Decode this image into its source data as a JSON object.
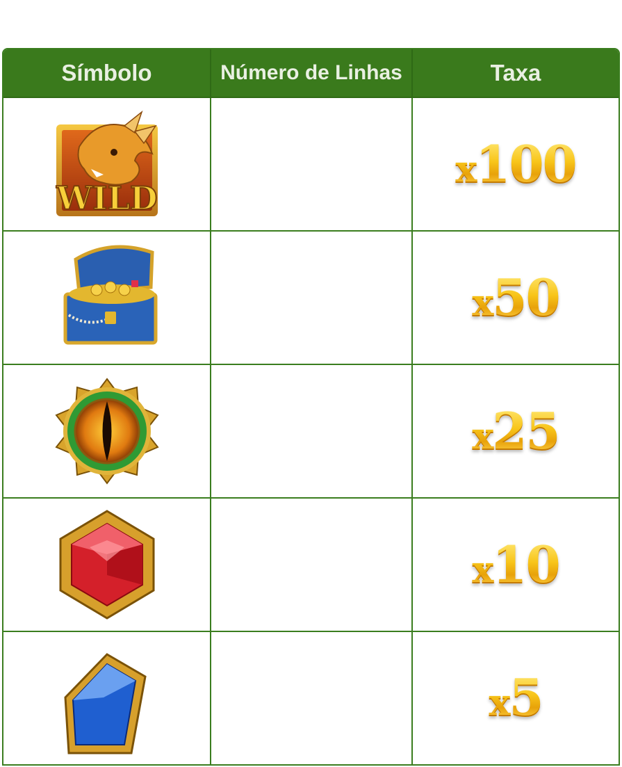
{
  "header": {
    "symbol_col": "Símbolo",
    "lines_col": "Número de Linhas",
    "rate_col": "Taxa"
  },
  "rows": [
    {
      "symbol_icon": "wild-dragon-icon",
      "wild_text": "WILD",
      "lines": "",
      "rate_x": "x",
      "rate_value": "100"
    },
    {
      "symbol_icon": "treasure-chest-icon",
      "lines": "",
      "rate_x": "x",
      "rate_value": "50"
    },
    {
      "symbol_icon": "dragon-eye-icon",
      "lines": "",
      "rate_x": "x",
      "rate_value": "25"
    },
    {
      "symbol_icon": "red-gem-icon",
      "lines": "",
      "rate_x": "x",
      "rate_value": "10"
    },
    {
      "symbol_icon": "blue-gem-icon",
      "lines": "",
      "rate_x": "x",
      "rate_value": "5"
    }
  ],
  "colors": {
    "header_bg": "#3a7a1c",
    "border": "#3a7d1e",
    "header_text": "#e9f0e2",
    "gold": "#f6c419"
  }
}
